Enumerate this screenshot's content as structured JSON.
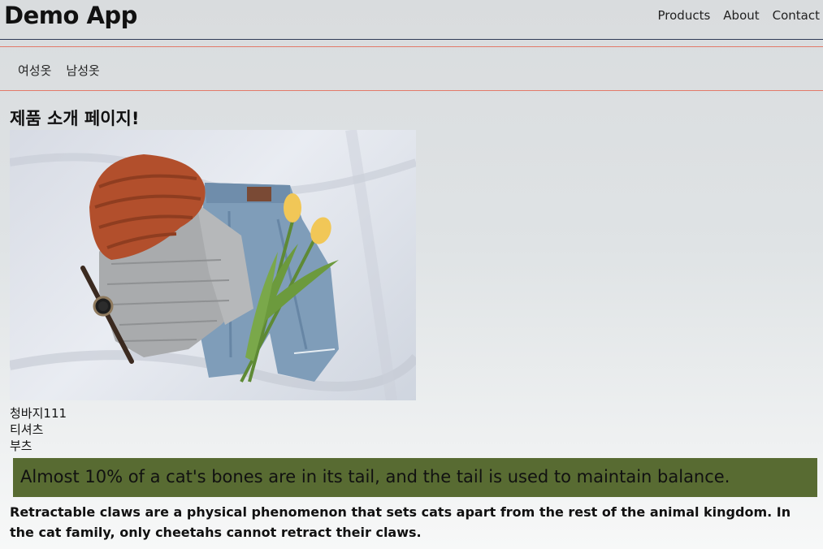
{
  "header": {
    "brand": "Demo App",
    "nav": [
      "Products",
      "About",
      "Contact"
    ]
  },
  "categories": [
    "여성옷",
    "남성옷"
  ],
  "main": {
    "title": "제품 소개 페이지!",
    "products": [
      "청바지111",
      "티셔츠",
      "부츠"
    ],
    "banner_text": "Almost 10% of a cat's bones are in its tail, and the tail is used to maintain balance.",
    "paragraph": "Retractable claws are a physical phenomenon that sets cats apart from the rest of the animal kingdom. In the cat family, only cheetahs cannot retract their claws."
  },
  "colors": {
    "banner": "#586b32",
    "header_border": "#2f3b57",
    "category_border": "#e27a6a"
  },
  "image": {
    "name": "clothing-flatlay-photo"
  }
}
